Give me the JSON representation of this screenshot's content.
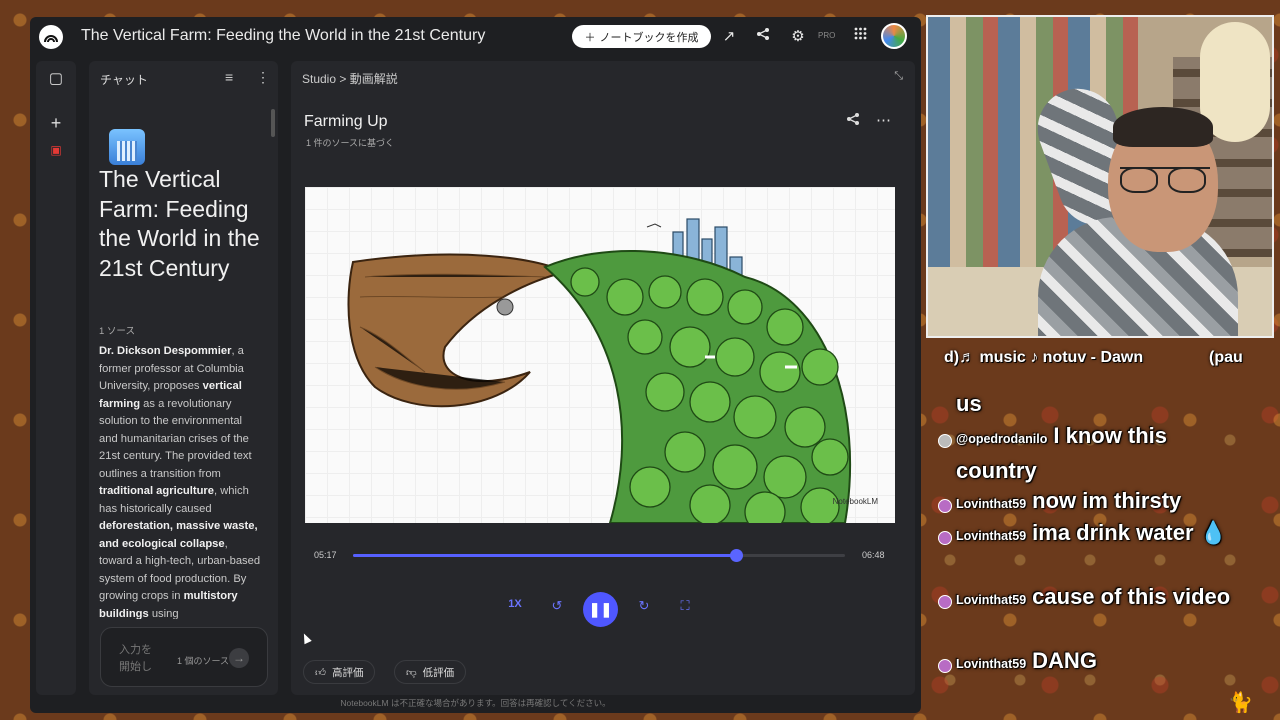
{
  "app": {
    "title": "The Vertical Farm: Feeding the World in the 21st Century",
    "create_notebook": "ノートブックを作成",
    "pro_badge": "PRO"
  },
  "chat": {
    "header": "チャット",
    "notebook_title": "The Vertical Farm: Feeding the World in the 21st Century",
    "source_count": "1 ソース",
    "summary_parts": [
      {
        "b": "Dr. Dickson Despommier"
      },
      {
        "t": ", a former professor at Columbia University, proposes "
      },
      {
        "b": "vertical farming"
      },
      {
        "t": " as a revolutionary solution to the environmental and humanitarian crises of the 21st century. The provided text outlines a transition from "
      },
      {
        "b": "traditional agriculture"
      },
      {
        "t": ", which has historically caused "
      },
      {
        "b": "deforestation, massive waste, and ecological collapse"
      },
      {
        "t": ", toward a high-tech, urban-based system of food production. By growing crops in "
      },
      {
        "b": "multistory buildings"
      },
      {
        "t": " using"
      }
    ],
    "input_placeholder": "入力を開始し",
    "input_sources": "1 個のソース"
  },
  "studio": {
    "crumb_root": "Studio",
    "crumb_sep": ">",
    "crumb_current": "動画解説",
    "video_title": "Farming Up",
    "video_subtitle": "1 件のソースに基づく",
    "watermark": "NotebookLM",
    "time_current": "05:17",
    "time_total": "06:48",
    "progress_fraction": 0.778,
    "speed": "1X",
    "like": "高評価",
    "dislike": "低評価"
  },
  "disclaimer": "NotebookLM は不正確な場合があります。回答は再確認してください。",
  "stream": {
    "song": "d)♬ music ♪ notuv - Dawn",
    "song_tail": "(pau",
    "messages": [
      {
        "user": "",
        "text": "us",
        "badge": "none"
      },
      {
        "user": "@opedrodanilo",
        "text": "I know this country",
        "badge": "grey"
      },
      {
        "user": "Lovinthat59",
        "text": "now im thirsty",
        "badge": "pink"
      },
      {
        "user": "Lovinthat59",
        "text": "ima drink water 💧",
        "badge": "pink"
      },
      {
        "user": "Lovinthat59",
        "text": "cause of this video",
        "badge": "pink"
      },
      {
        "user": "Lovinthat59",
        "text": "DANG",
        "badge": "pink"
      }
    ]
  },
  "colors": {
    "accent": "#5660ff",
    "panel": "#26272b",
    "bg": "#1e1f22"
  }
}
